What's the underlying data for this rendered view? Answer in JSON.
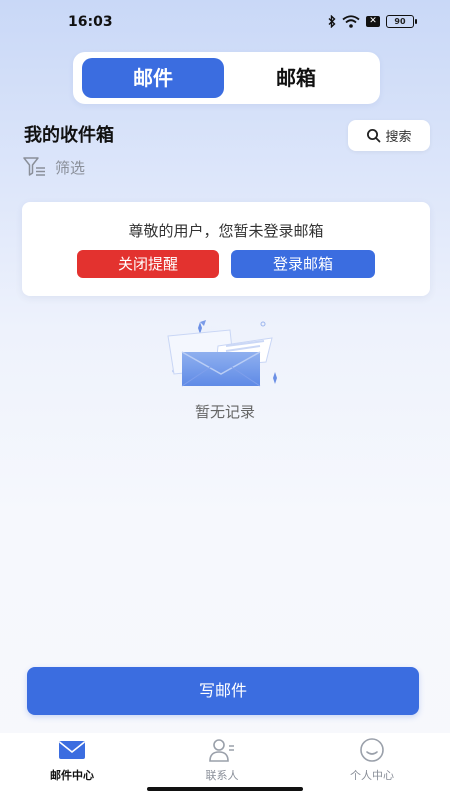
{
  "status_bar": {
    "time": "16:03",
    "battery": "90",
    "icons": [
      "bluetooth-icon",
      "wifi-icon",
      "x-box-icon",
      "battery-icon"
    ]
  },
  "segment": {
    "tabs": [
      {
        "label": "邮件",
        "active": true
      },
      {
        "label": "邮箱",
        "active": false
      }
    ]
  },
  "inbox": {
    "title": "我的收件箱",
    "search_label": "搜索",
    "filter_label": "筛选"
  },
  "login_card": {
    "message": "尊敬的用户，您暂未登录邮箱",
    "close_label": "关闭提醒",
    "login_label": "登录邮箱"
  },
  "empty_state": {
    "text": "暂无记录"
  },
  "compose": {
    "label": "写邮件"
  },
  "tabbar": {
    "items": [
      {
        "label": "邮件中心",
        "icon": "mail-icon",
        "active": true
      },
      {
        "label": "联系人",
        "icon": "contacts-icon",
        "active": false
      },
      {
        "label": "个人中心",
        "icon": "smile-icon",
        "active": false
      }
    ]
  },
  "colors": {
    "primary": "#3b6de0",
    "danger": "#e3322f"
  }
}
